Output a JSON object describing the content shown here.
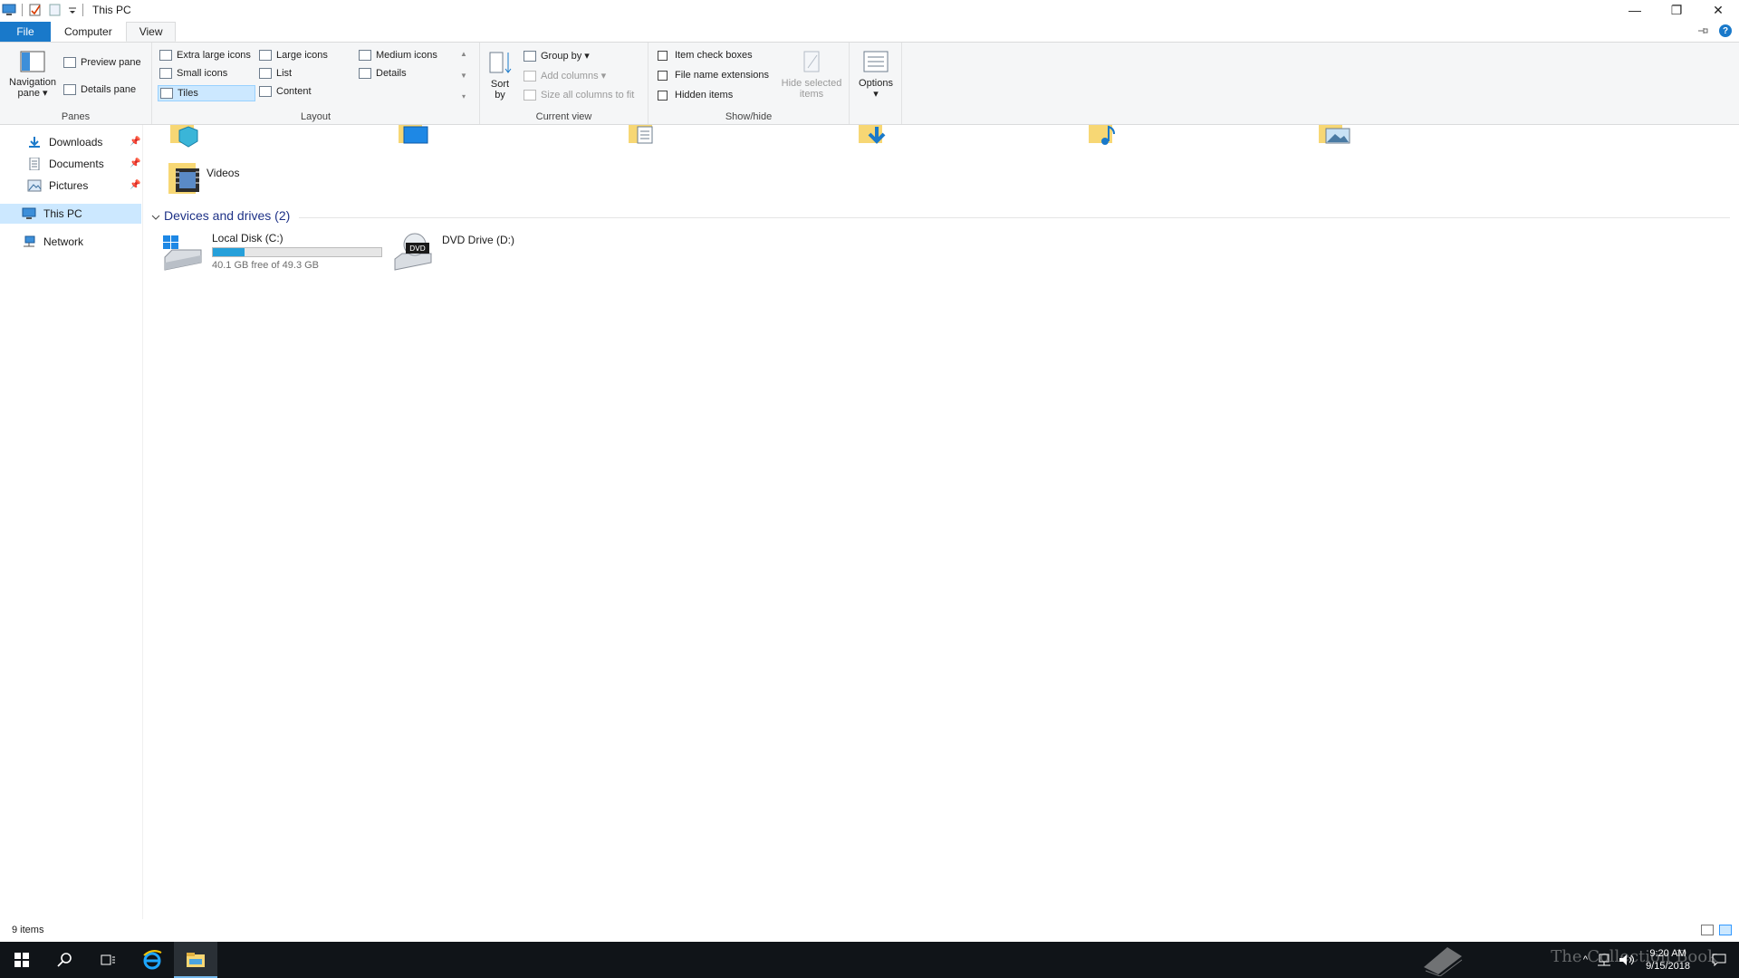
{
  "window": {
    "title": "This PC",
    "controls": {
      "minimize": "—",
      "restore": "❐",
      "close": "✕"
    }
  },
  "tabs": [
    {
      "label": "File"
    },
    {
      "label": "Computer"
    },
    {
      "label": "View"
    }
  ],
  "ribbon": {
    "panes": {
      "navigation_pane": "Navigation pane",
      "preview_pane": "Preview pane",
      "details_pane": "Details pane",
      "group_label": "Panes"
    },
    "layout": {
      "items": [
        "Extra large icons",
        "Large icons",
        "Medium icons",
        "Small icons",
        "List",
        "Details",
        "Tiles",
        "Content"
      ],
      "selected": "Tiles",
      "group_label": "Layout"
    },
    "current_view": {
      "sort_by": "Sort by",
      "group_by": "Group by",
      "add_columns": "Add columns",
      "size_columns": "Size all columns to fit",
      "group_label": "Current view"
    },
    "show_hide": {
      "item_check_boxes": "Item check boxes",
      "file_name_extensions": "File name extensions",
      "hidden_items": "Hidden items",
      "hide_selected": "Hide selected items",
      "group_label": "Show/hide"
    },
    "options": "Options"
  },
  "nav": {
    "items": [
      {
        "label": "Downloads",
        "pinned": true
      },
      {
        "label": "Documents",
        "pinned": true
      },
      {
        "label": "Pictures",
        "pinned": true
      },
      {
        "label": "This PC",
        "pinned": false
      },
      {
        "label": "Network",
        "pinned": false
      }
    ],
    "pin_glyph": "📌"
  },
  "content": {
    "videos": "Videos",
    "section_title": "Devices and drives (2)",
    "drives": [
      {
        "name": "Local Disk (C:)",
        "free": "40.1 GB free of 49.3 GB",
        "used_fraction": 0.187
      },
      {
        "name": "DVD Drive (D:)",
        "label": "DVD"
      }
    ]
  },
  "status": {
    "items": "9 items"
  },
  "taskbar": {
    "time": "9:20 AM",
    "date": "9/15/2018",
    "watermark": "The Collection Book"
  },
  "colors": {
    "accent": "#1979ca",
    "drive_fill": "#26a0da",
    "selection": "#cce8ff"
  }
}
